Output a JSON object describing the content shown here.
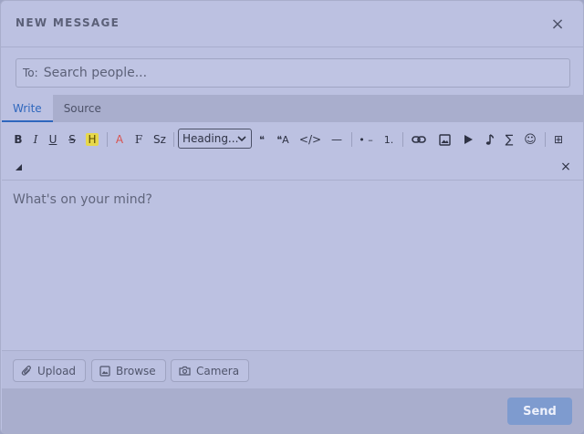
{
  "dialog": {
    "title": "NEW MESSAGE",
    "close_icon": "×"
  },
  "to_field": {
    "label": "To:",
    "placeholder": "Search people..."
  },
  "tabs": [
    {
      "label": "Write",
      "active": true
    },
    {
      "label": "Source",
      "active": false
    }
  ],
  "toolbar": {
    "bold": "B",
    "italic": "I",
    "underline": "U",
    "strike": "S",
    "highlight": "H",
    "font_color": "A",
    "font_family": "F",
    "font_size": "Sz",
    "heading_select": "Heading...",
    "quote": "❝",
    "block_quote": "❝A",
    "code": "</>",
    "horizontal_rule": "—",
    "bullet_list": "• –",
    "numbered_list": "1.",
    "emoji": "☺",
    "formula": "∑",
    "table": "⊞",
    "clear": "×"
  },
  "editor": {
    "placeholder": "What's on your mind?"
  },
  "attachments": [
    {
      "label": "Upload",
      "icon": "paperclip-icon"
    },
    {
      "label": "Browse",
      "icon": "image-icon"
    },
    {
      "label": "Camera",
      "icon": "camera-icon"
    }
  ],
  "footer": {
    "send_label": "Send"
  },
  "colors": {
    "accent": "#2f67bd",
    "send_button": "#7e9bcf",
    "font_color_icon": "#d9534f",
    "highlight": "#e7d84a"
  }
}
